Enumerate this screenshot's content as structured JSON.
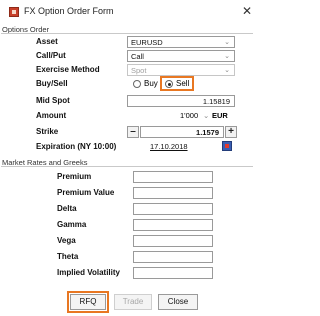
{
  "window": {
    "title": "FX Option Order Form",
    "close_glyph": "✕",
    "icon": "app-icon"
  },
  "options_order": {
    "section_label": "Options Order",
    "asset": {
      "label": "Asset",
      "value": "EURUSD"
    },
    "call_put": {
      "label": "Call/Put",
      "value": "Call"
    },
    "exercise_method": {
      "label": "Exercise Method",
      "value": "Spot"
    },
    "buy_sell": {
      "label": "Buy/Sell",
      "buy_label": "Buy",
      "sell_label": "Sell",
      "selected": "Sell"
    },
    "mid_spot": {
      "label": "Mid Spot",
      "value": "1.15819"
    },
    "amount": {
      "label": "Amount",
      "value": "1'000",
      "currency": "EUR"
    },
    "strike": {
      "label": "Strike",
      "value": "1.1579",
      "decrement": "–",
      "increment": "+"
    },
    "expiration": {
      "label": "Expiration (NY 10:00)",
      "value": "17.10.2018"
    }
  },
  "market_rates": {
    "section_label": "Market Rates and Greeks",
    "fields": [
      {
        "label": "Premium"
      },
      {
        "label": "Premium Value"
      },
      {
        "label": "Delta"
      },
      {
        "label": "Gamma"
      },
      {
        "label": "Vega"
      },
      {
        "label": "Theta"
      },
      {
        "label": "Implied Volatility"
      }
    ]
  },
  "buttons": {
    "rfq": "RFQ",
    "trade": "Trade",
    "close": "Close"
  },
  "colors": {
    "highlight": "#e87722",
    "app_icon": "#c8402a"
  }
}
